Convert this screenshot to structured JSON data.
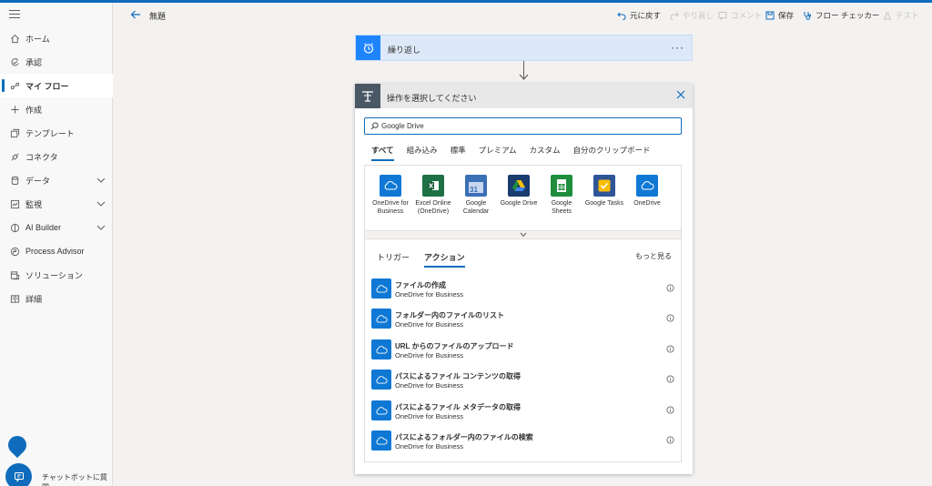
{
  "sidebar": {
    "items": [
      {
        "label": "ホーム",
        "icon": "home-icon"
      },
      {
        "label": "承認",
        "icon": "approvals-icon"
      },
      {
        "label": "マイ フロー",
        "icon": "flow-icon",
        "active": true
      },
      {
        "label": "作成",
        "icon": "plus-icon"
      },
      {
        "label": "テンプレート",
        "icon": "templates-icon"
      },
      {
        "label": "コネクタ",
        "icon": "connector-icon"
      },
      {
        "label": "データ",
        "icon": "database-icon",
        "expandable": true
      },
      {
        "label": "監視",
        "icon": "monitor-icon",
        "expandable": true
      },
      {
        "label": "AI Builder",
        "icon": "ai-builder-icon",
        "expandable": true
      },
      {
        "label": "Process Advisor",
        "icon": "process-advisor-icon"
      },
      {
        "label": "ソリューション",
        "icon": "solutions-icon"
      },
      {
        "label": "詳細",
        "icon": "book-icon"
      }
    ],
    "chatbot_label": "チャットボットに質問"
  },
  "cmdbar": {
    "title": "無題",
    "undo": "元に戻す",
    "redo": "やり直し",
    "comment": "コメント",
    "save": "保存",
    "checker": "フロー チェッカー",
    "test": "テスト"
  },
  "trigger": {
    "title": "繰り返し",
    "more": "···"
  },
  "panel": {
    "title": "操作を選択してください",
    "search_value": "Google Drive",
    "tabs": [
      "すべて",
      "組み込み",
      "標準",
      "プレミアム",
      "カスタム",
      "自分のクリップボード"
    ],
    "connectors": [
      {
        "name": "OneDrive for Business",
        "lines": [
          "OneDrive for",
          "Business"
        ],
        "color": "#0f78d4",
        "icon": "onedrive-icon"
      },
      {
        "name": "Excel Online (OneDrive)",
        "lines": [
          "Excel Online",
          "(OneDrive)"
        ],
        "color": "#1e7145",
        "icon": "excel-icon"
      },
      {
        "name": "Google Calendar",
        "lines": [
          "Google",
          "Calendar"
        ],
        "color": "#3b6fb6",
        "icon": "calendar-icon",
        "badge": "31"
      },
      {
        "name": "Google Drive",
        "lines": [
          "Google Drive"
        ],
        "color": "#1a3c6e",
        "icon": "google-drive-icon"
      },
      {
        "name": "Google Sheets",
        "lines": [
          "Google",
          "Sheets"
        ],
        "color": "#1e8e3e",
        "icon": "sheets-icon"
      },
      {
        "name": "Google Tasks",
        "lines": [
          "Google Tasks"
        ],
        "color": "#2f5597",
        "icon": "tasks-icon"
      },
      {
        "name": "OneDrive",
        "lines": [
          "OneDrive"
        ],
        "color": "#0f78d4",
        "icon": "onedrive-icon"
      }
    ],
    "action_tabs": [
      "トリガー",
      "アクション"
    ],
    "see_more": "もっと見る",
    "actions": [
      {
        "name": "ファイルの作成",
        "connector": "OneDrive for Business"
      },
      {
        "name": "フォルダー内のファイルのリスト",
        "connector": "OneDrive for Business"
      },
      {
        "name": "URL からのファイルのアップロード",
        "connector": "OneDrive for Business"
      },
      {
        "name": "パスによるファイル コンテンツの取得",
        "connector": "OneDrive for Business"
      },
      {
        "name": "パスによるファイル メタデータの取得",
        "connector": "OneDrive for Business"
      },
      {
        "name": "パスによるフォルダー内のファイルの検索",
        "connector": "OneDrive for Business"
      }
    ]
  }
}
